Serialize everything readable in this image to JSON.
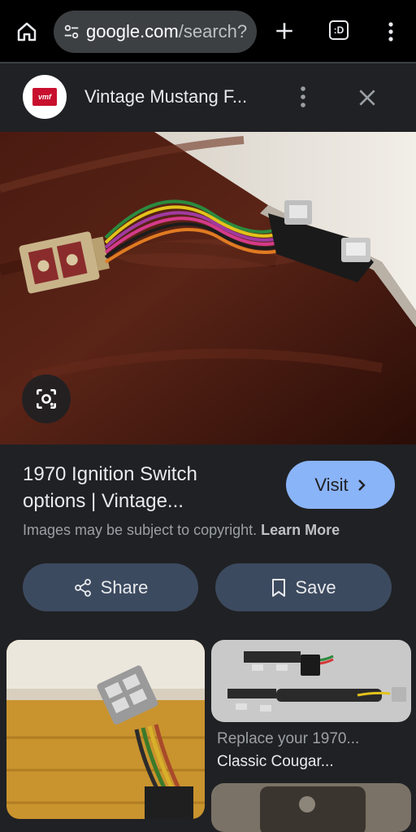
{
  "browser": {
    "url_host": "google.com",
    "url_path": "/search?",
    "tabs_label": ":D"
  },
  "sheet": {
    "site_name": "Vintage Mustang F...",
    "logo_text": "vmf"
  },
  "result": {
    "title_line1": "1970 Ignition Switch",
    "title_line2": "options | Vintage...",
    "visit_label": "Visit",
    "copyright_text": "Images may be subject to copyright.",
    "learn_more_label": "Learn More",
    "share_label": "Share",
    "save_label": "Save"
  },
  "related": [
    {
      "caption_line1": "Replace your 1970...",
      "caption_line2": "Classic Cougar..."
    }
  ],
  "colors": {
    "accent": "#8ab4f8",
    "background": "#202124",
    "pill": "#3c4a5f",
    "urlbar": "#3c4043"
  }
}
